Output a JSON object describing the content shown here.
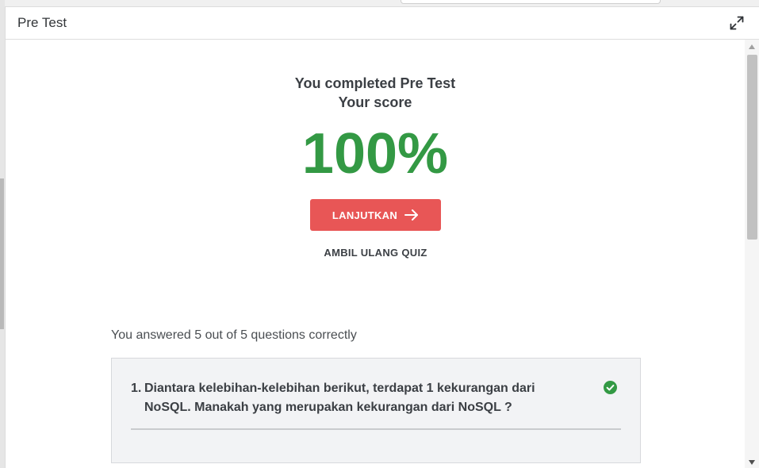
{
  "modal": {
    "title": "Pre Test",
    "expand_icon": "expand-arrows-icon"
  },
  "result": {
    "completed_text": "You completed Pre Test",
    "score_label": "Your score",
    "score_value": "100%",
    "score_color": "#339944"
  },
  "actions": {
    "continue_label": "LANJUTKAN",
    "continue_icon": "arrow-right-icon",
    "continue_color": "#e85656",
    "retake_label": "AMBIL ULANG QUIZ"
  },
  "summary": {
    "text": "You answered 5 out of 5 questions correctly"
  },
  "questions": [
    {
      "number": "1.",
      "text_line1": "Diantara kelebihan-kelebihan berikut, terdapat 1 kekurangan dari",
      "text_line2": "NoSQL. Manakah yang merupakan kekurangan dari NoSQL ?",
      "status_icon": "check-circle-icon",
      "status_color": "#339944"
    }
  ]
}
